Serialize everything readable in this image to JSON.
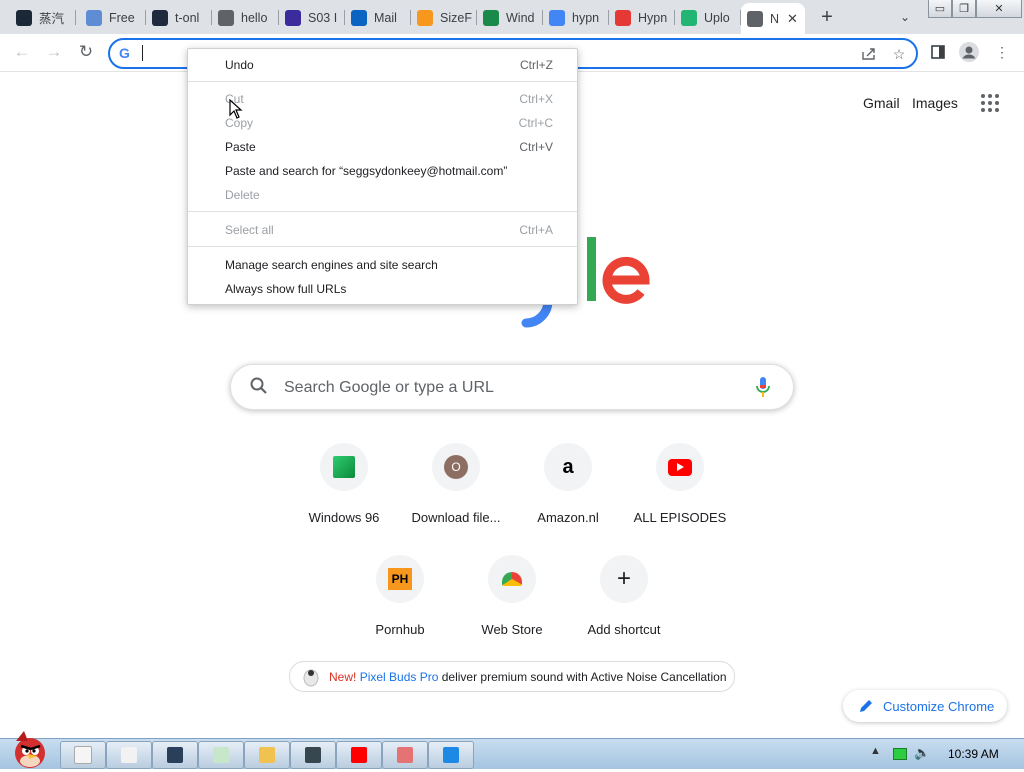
{
  "tabs": [
    {
      "label": "蒸汽",
      "icon": "steam-icon",
      "color": "#1b2838"
    },
    {
      "label": "Free",
      "icon": "star-icon",
      "color": "#5f8dd3"
    },
    {
      "label": "t-onl",
      "icon": "tumblr-icon",
      "color": "#1f2a3c"
    },
    {
      "label": "hello",
      "icon": "globe-icon",
      "color": "#5f6368"
    },
    {
      "label": "S03 I",
      "icon": "audio-bars-icon",
      "color": "#3b2b9c"
    },
    {
      "label": "Mail",
      "icon": "outlook-icon",
      "color": "#0a64c2"
    },
    {
      "label": "SizeF",
      "icon": "ph-icon",
      "color": "#f7971d"
    },
    {
      "label": "Wind",
      "icon": "windows-icon",
      "color": "#1a8a4a"
    },
    {
      "label": "hypn",
      "icon": "google-icon",
      "color": "#4285f4"
    },
    {
      "label": "Hypn",
      "icon": "lock-icon",
      "color": "#e53935"
    },
    {
      "label": "Uplo",
      "icon": "upload-cloud-icon",
      "color": "#22b573"
    },
    {
      "label": "N",
      "icon": "chrome-icon",
      "color": "#5f6368",
      "active": true
    }
  ],
  "window_controls": {
    "minimize": "▭",
    "restore": "❐",
    "close": "✕"
  },
  "toolbar": {
    "omnibox_value": ""
  },
  "context_menu": {
    "groups": [
      [
        {
          "label": "Undo",
          "shortcut": "Ctrl+Z",
          "enabled": true
        }
      ],
      [
        {
          "label": "Cut",
          "shortcut": "Ctrl+X",
          "enabled": false
        },
        {
          "label": "Copy",
          "shortcut": "Ctrl+C",
          "enabled": false
        },
        {
          "label": "Paste",
          "shortcut": "Ctrl+V",
          "enabled": true
        },
        {
          "label": "Paste and search for “seggsydonkeey@hotmail.com”",
          "shortcut": "",
          "enabled": true
        },
        {
          "label": "Delete",
          "shortcut": "",
          "enabled": false
        }
      ],
      [
        {
          "label": "Select all",
          "shortcut": "Ctrl+A",
          "enabled": false
        }
      ],
      [
        {
          "label": "Manage search engines and site search",
          "shortcut": "",
          "enabled": true
        },
        {
          "label": "Always show full URLs",
          "shortcut": "",
          "enabled": true
        }
      ]
    ]
  },
  "header_links": {
    "gmail": "Gmail",
    "images": "Images"
  },
  "logo": {
    "visible_text": "gle",
    "colors": [
      "#4285f4",
      "#34a853",
      "#ea4335"
    ]
  },
  "search": {
    "placeholder": "Search Google or type a URL"
  },
  "shortcuts": [
    {
      "label": "Windows 96",
      "icon": "windows96-icon"
    },
    {
      "label": "Download file...",
      "icon": "letter-o-icon",
      "glyph": "O"
    },
    {
      "label": "Amazon.nl",
      "icon": "amazon-icon",
      "glyph": "a"
    },
    {
      "label": "ALL EPISODES",
      "icon": "youtube-icon"
    },
    {
      "label": "Pornhub",
      "icon": "ph-icon",
      "glyph": "PH"
    },
    {
      "label": "Web Store",
      "icon": "webstore-icon"
    },
    {
      "label": "Add shortcut",
      "icon": "plus-icon",
      "glyph": "+"
    }
  ],
  "promo": {
    "new_label": "New!",
    "product": "Pixel Buds Pro",
    "rest": " deliver premium sound with Active Noise Cancellation"
  },
  "customize": {
    "label": "Customize Chrome"
  },
  "taskbar": {
    "items": [
      {
        "icon": "notepad-icon",
        "color": "#f2f2f2"
      },
      {
        "icon": "steam-icon",
        "color": "#2a3f5a"
      },
      {
        "icon": "notes-icon",
        "color": "#c8e6c9"
      },
      {
        "icon": "folder-icon",
        "color": "#f0c24f"
      },
      {
        "icon": "terminal-icon",
        "color": "#37474f"
      },
      {
        "icon": "youtube-icon",
        "color": "#ff0000"
      },
      {
        "icon": "paint-icon",
        "color": "#e57373"
      },
      {
        "icon": "globe-icon",
        "color": "#1e88e5"
      }
    ],
    "clock": "10:39 AM"
  }
}
